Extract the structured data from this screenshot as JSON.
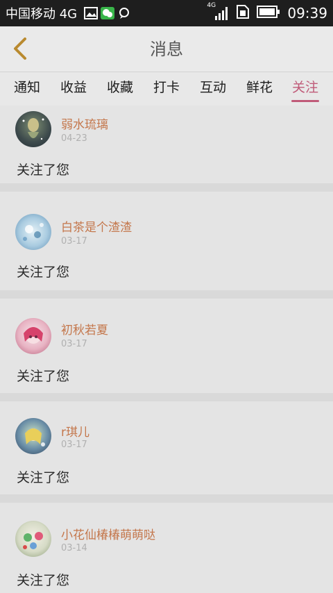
{
  "status_bar": {
    "carrier": "中国移动 4G",
    "network_label": "4G",
    "time": "09:39"
  },
  "header": {
    "title": "消息"
  },
  "tabs": [
    {
      "label": "通知",
      "active": false
    },
    {
      "label": "收益",
      "active": false
    },
    {
      "label": "收藏",
      "active": false
    },
    {
      "label": "打卡",
      "active": false
    },
    {
      "label": "互动",
      "active": false
    },
    {
      "label": "鲜花",
      "active": false
    },
    {
      "label": "关注",
      "active": true
    }
  ],
  "notifications": [
    {
      "user": "弱水琉璃",
      "date": "04-23",
      "message": "关注了您"
    },
    {
      "user": "白茶是个渣渣",
      "date": "03-17",
      "message": "关注了您"
    },
    {
      "user": "初秋若夏",
      "date": "03-17",
      "message": "关注了您"
    },
    {
      "user": "r琪儿",
      "date": "03-17",
      "message": "关注了您"
    },
    {
      "user": "小花仙椿椿萌萌哒",
      "date": "03-14",
      "message": "关注了您"
    }
  ],
  "colors": {
    "accent": "#c05a78",
    "username": "#c4774c"
  }
}
